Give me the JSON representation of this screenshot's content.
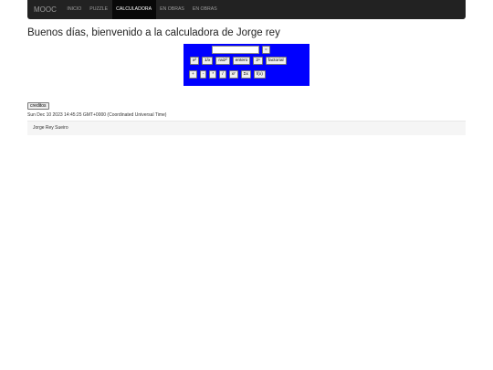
{
  "nav": {
    "brand": "MOOC",
    "items": [
      "INICIO",
      "PUZZLE",
      "CALCULADORA",
      "EN OBRAS",
      "EN OBRAS"
    ],
    "active_index": 2
  },
  "heading": "Buenos días, bienvenido a la calculadora de Jorge rey",
  "calculator": {
    "display_value": "",
    "equals_label": "=",
    "row1": [
      "x²",
      "1/x",
      "raiz²",
      "entero",
      "2ⁿ",
      "factorial"
    ],
    "row2": [
      "+",
      "-",
      "*",
      "/",
      "xʸ",
      "Σx",
      "f(x)"
    ]
  },
  "credits_label": "creditos",
  "date_text": "Sun Dec 10 2023 14:45:25 GMT+0000 (Coordinated Universal Time)",
  "author": "Jorge Rey Sueiro",
  "colors": {
    "navbar": "#222222",
    "calc_bg": "#0000ff",
    "footer_bg": "#f5f5f5"
  }
}
